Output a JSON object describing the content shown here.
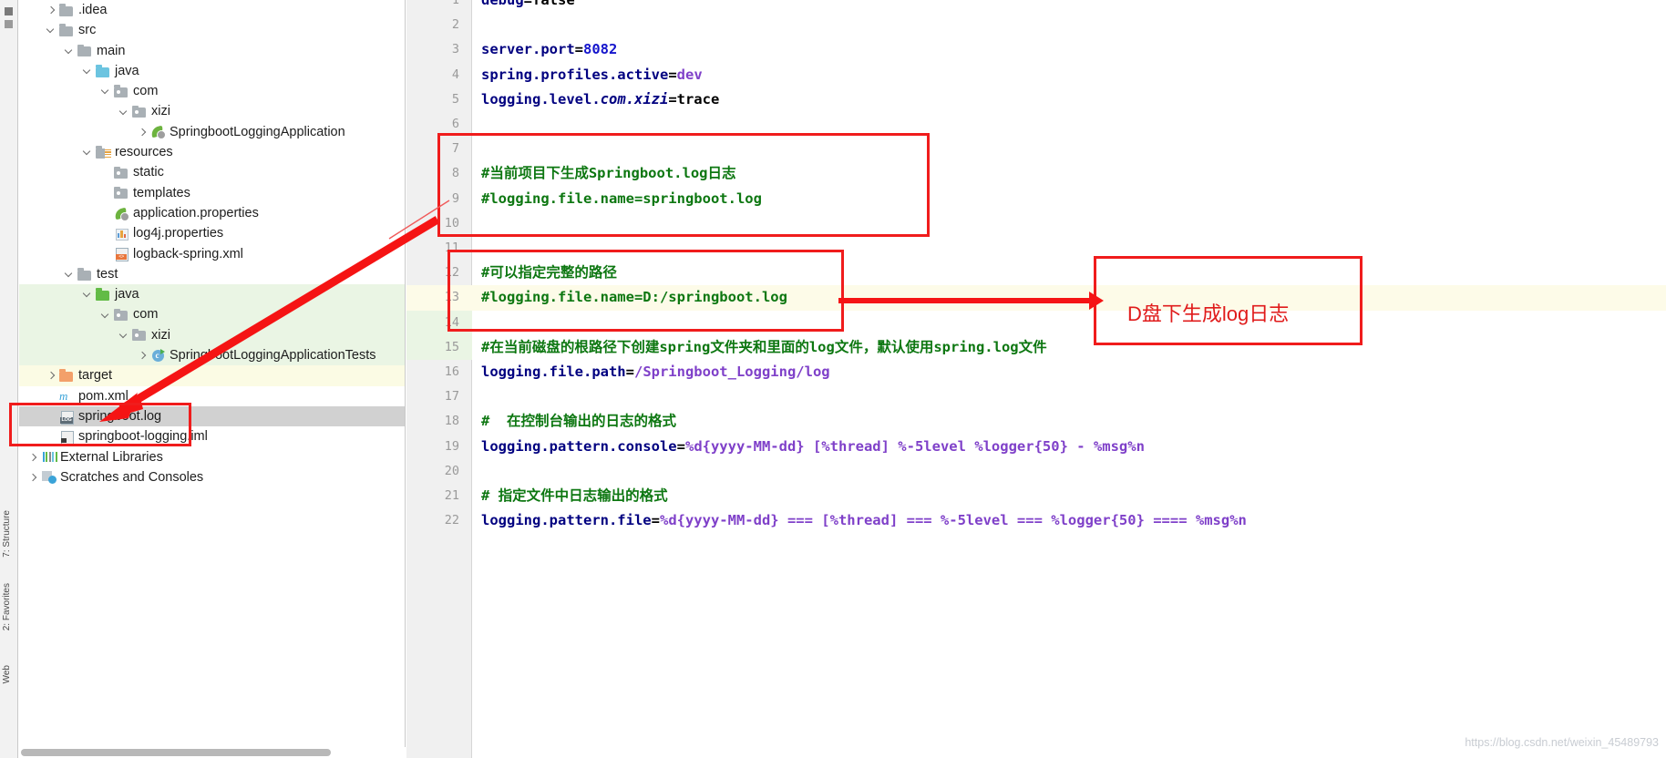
{
  "window": {
    "toolstrip_tabs": [
      "7: Structure",
      "2: Favorites",
      "Web"
    ]
  },
  "project_tree": {
    "items": [
      {
        "indent": 1,
        "chevron": "closed",
        "icon": "folder",
        "label": ".idea",
        "highlight": "none"
      },
      {
        "indent": 1,
        "chevron": "open",
        "icon": "folder",
        "label": "src",
        "highlight": "none"
      },
      {
        "indent": 2,
        "chevron": "open",
        "icon": "folder",
        "label": "main",
        "highlight": "none"
      },
      {
        "indent": 3,
        "chevron": "open",
        "icon": "folder-blue",
        "label": "java",
        "highlight": "none"
      },
      {
        "indent": 4,
        "chevron": "open",
        "icon": "folder-dot",
        "label": "com",
        "highlight": "none"
      },
      {
        "indent": 5,
        "chevron": "open",
        "icon": "folder-dot",
        "label": "xizi",
        "highlight": "none"
      },
      {
        "indent": 6,
        "chevron": "closed",
        "icon": "spring",
        "label": "SpringbootLoggingApplication",
        "highlight": "none"
      },
      {
        "indent": 3,
        "chevron": "open",
        "icon": "folder-res",
        "label": "resources",
        "highlight": "none"
      },
      {
        "indent": 4,
        "chevron": "none",
        "icon": "folder-dot",
        "label": "static",
        "highlight": "none"
      },
      {
        "indent": 4,
        "chevron": "none",
        "icon": "folder-dot",
        "label": "templates",
        "highlight": "none"
      },
      {
        "indent": 4,
        "chevron": "none",
        "icon": "spring",
        "label": "application.properties",
        "highlight": "none"
      },
      {
        "indent": 4,
        "chevron": "none",
        "icon": "props",
        "label": "log4j.properties",
        "highlight": "none"
      },
      {
        "indent": 4,
        "chevron": "none",
        "icon": "xmlf",
        "label": "logback-spring.xml",
        "highlight": "none"
      },
      {
        "indent": 2,
        "chevron": "open",
        "icon": "folder",
        "label": "test",
        "highlight": "none"
      },
      {
        "indent": 3,
        "chevron": "open",
        "icon": "folder-green",
        "label": "java",
        "highlight": "green"
      },
      {
        "indent": 4,
        "chevron": "open",
        "icon": "folder-dot",
        "label": "com",
        "highlight": "green"
      },
      {
        "indent": 5,
        "chevron": "open",
        "icon": "folder-dot",
        "label": "xizi",
        "highlight": "green"
      },
      {
        "indent": 6,
        "chevron": "closed",
        "icon": "jclass",
        "label": "SpringbootLoggingApplicationTests",
        "highlight": "green"
      },
      {
        "indent": 1,
        "chevron": "closed",
        "icon": "folder-orange",
        "label": "target",
        "highlight": "yellow"
      },
      {
        "indent": 1,
        "chevron": "none",
        "icon": "maven",
        "label": "pom.xml",
        "highlight": "none"
      },
      {
        "indent": 1,
        "chevron": "none",
        "icon": "logf",
        "label": "springboot.log",
        "highlight": "sel"
      },
      {
        "indent": 1,
        "chevron": "none",
        "icon": "imlf",
        "label": "springboot-logging.iml",
        "highlight": "none"
      },
      {
        "indent": 0,
        "chevron": "closed",
        "icon": "libs",
        "label": "External Libraries",
        "highlight": "none"
      },
      {
        "indent": 0,
        "chevron": "closed",
        "icon": "scratch",
        "label": "Scratches and Consoles",
        "highlight": "none"
      }
    ]
  },
  "editor": {
    "file": "application.properties",
    "lines": [
      {
        "n": "1",
        "row_bg": "none",
        "tokens": [
          {
            "t": "debug",
            "c": "key"
          },
          {
            "t": "=",
            "c": "plain"
          },
          {
            "t": "false",
            "c": "plain"
          }
        ]
      },
      {
        "n": "2",
        "row_bg": "none",
        "tokens": []
      },
      {
        "n": "3",
        "row_bg": "none",
        "tokens": [
          {
            "t": "server.port",
            "c": "key"
          },
          {
            "t": "=",
            "c": "plain"
          },
          {
            "t": "8082",
            "c": "num"
          }
        ]
      },
      {
        "n": "4",
        "row_bg": "none",
        "tokens": [
          {
            "t": "spring.profiles.active",
            "c": "key"
          },
          {
            "t": "=",
            "c": "plain"
          },
          {
            "t": "dev",
            "c": "val"
          }
        ]
      },
      {
        "n": "5",
        "row_bg": "none",
        "tokens": [
          {
            "t": "logging.level.",
            "c": "key"
          },
          {
            "t": "com.xizi",
            "c": "ital"
          },
          {
            "t": "=trace",
            "c": "plain"
          }
        ]
      },
      {
        "n": "6",
        "row_bg": "none",
        "tokens": []
      },
      {
        "n": "7",
        "row_bg": "none",
        "tokens": []
      },
      {
        "n": "8",
        "row_bg": "none",
        "tokens": [
          {
            "t": "#当前项目下生成Springboot.log日志",
            "c": "cmt"
          }
        ]
      },
      {
        "n": "9",
        "row_bg": "none",
        "tokens": [
          {
            "t": "#logging.file.name=springboot.log",
            "c": "cmt"
          }
        ]
      },
      {
        "n": "10",
        "row_bg": "none",
        "tokens": []
      },
      {
        "n": "11",
        "row_bg": "none",
        "tokens": []
      },
      {
        "n": "12",
        "row_bg": "none",
        "tokens": [
          {
            "t": "#可以指定完整的路径",
            "c": "cmt"
          }
        ]
      },
      {
        "n": "13",
        "row_bg": "yellow",
        "tokens": [
          {
            "t": "#logging.file.name=D:/springboot.log",
            "c": "cmt"
          }
        ]
      },
      {
        "n": "14",
        "row_bg": "none",
        "tokens": []
      },
      {
        "n": "15",
        "row_bg": "none",
        "tokens": [
          {
            "t": "#在当前磁盘的根路径下创建spring文件夹和里面的log文件，默认使用spring.log文件",
            "c": "cmt"
          }
        ]
      },
      {
        "n": "16",
        "row_bg": "none",
        "tokens": [
          {
            "t": "logging.file.path",
            "c": "key"
          },
          {
            "t": "=",
            "c": "plain"
          },
          {
            "t": "/Springboot_Logging/log",
            "c": "val"
          }
        ]
      },
      {
        "n": "17",
        "row_bg": "none",
        "tokens": []
      },
      {
        "n": "18",
        "row_bg": "none",
        "tokens": [
          {
            "t": "#  在控制台输出的日志的格式",
            "c": "cmt"
          }
        ]
      },
      {
        "n": "19",
        "row_bg": "none",
        "tokens": [
          {
            "t": "logging.pattern.console",
            "c": "key"
          },
          {
            "t": "=",
            "c": "plain"
          },
          {
            "t": "%d{yyyy-MM-dd} [%thread] %-5level %logger{50} - %msg%n",
            "c": "val"
          }
        ]
      },
      {
        "n": "20",
        "row_bg": "none",
        "tokens": []
      },
      {
        "n": "21",
        "row_bg": "none",
        "tokens": [
          {
            "t": "# 指定文件中日志输出的格式",
            "c": "cmt"
          }
        ]
      },
      {
        "n": "22",
        "row_bg": "none",
        "tokens": [
          {
            "t": "logging.pattern.file",
            "c": "key"
          },
          {
            "t": "=",
            "c": "plain"
          },
          {
            "t": "%d{yyyy-MM-dd} === [%thread] === %-5level === %logger{50} ==== %msg%n",
            "c": "val"
          }
        ]
      }
    ]
  },
  "annotations": {
    "callout_label": "D盘下生成log日志",
    "accent_color": "#f01c1c"
  },
  "watermark": {
    "text": "https://blog.csdn.net/weixin_45489793"
  }
}
